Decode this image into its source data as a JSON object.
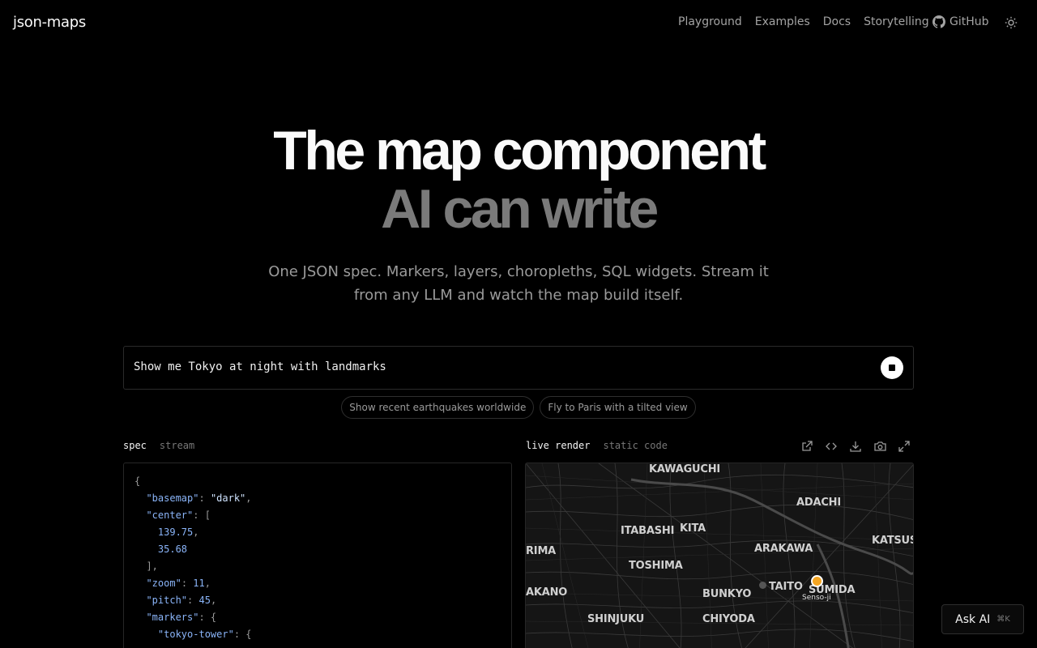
{
  "nav": {
    "logo": "json-maps",
    "links": [
      "Playground",
      "Examples",
      "Docs",
      "Storytelling"
    ],
    "github": "GitHub",
    "github_icon": "github-icon",
    "theme_icon": "sun-icon"
  },
  "hero": {
    "line1": "The map component",
    "line2": "AI can write",
    "subtitle": "One JSON spec. Markers, layers, choropleths, SQL widgets. Stream it from any LLM and watch the map build itself."
  },
  "prompt": {
    "value": "Show me Tokyo at night with landmarks",
    "stop_icon": "stop-icon"
  },
  "suggestions": [
    "Show recent earthquakes worldwide",
    "Fly to Paris with a tilted view"
  ],
  "left_panel": {
    "tabs": [
      "spec",
      "stream"
    ],
    "active_tab": "spec",
    "code_lines": [
      "{",
      "  \"basemap\": \"dark\",",
      "  \"center\": [",
      "    139.75,",
      "    35.68",
      "  ],",
      "  \"zoom\": 11,",
      "  \"pitch\": 45,",
      "  \"markers\": {",
      "    \"tokyo-tower\": {"
    ]
  },
  "right_panel": {
    "tabs": [
      "live render",
      "static code"
    ],
    "active_tab": "live render",
    "tool_icons": [
      "external-link-icon",
      "code-icon",
      "download-icon",
      "camera-icon",
      "expand-icon"
    ],
    "map_labels": [
      "KAWAGUCHI",
      "ADACHI",
      "ITABASHI",
      "KITA",
      "KATSUS",
      "RIMA",
      "ARAKAWA",
      "TOSHIMA",
      "TAITO",
      "SUMIDA",
      "AKANO",
      "BUNKYO",
      "SHINJUKU",
      "CHIYODA"
    ],
    "marker_label": "Senso-ji",
    "marker_color": "#f5a623"
  },
  "ask_ai": {
    "label": "Ask AI",
    "shortcut": "⌘K"
  }
}
